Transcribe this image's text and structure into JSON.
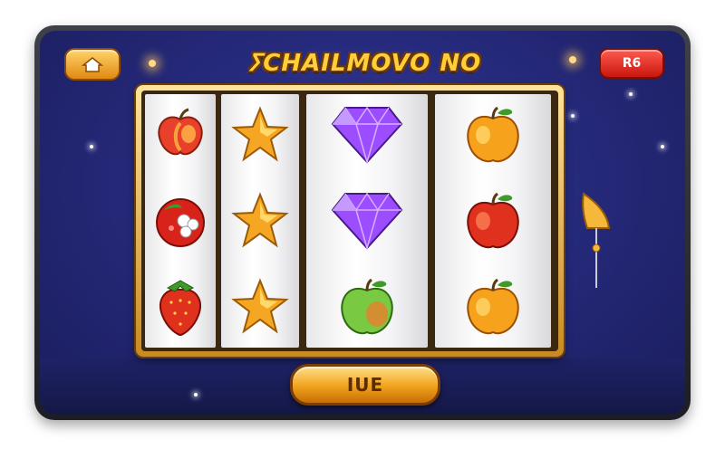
{
  "game": {
    "title": "ⵢCHAILMOVO NO",
    "badge_label": "R6",
    "spin_label": "IUE"
  },
  "reels": [
    {
      "symbols": [
        "peach",
        "strawberry-cut",
        "strawberry"
      ]
    },
    {
      "symbols": [
        "star",
        "star",
        "star"
      ]
    },
    {
      "symbols": [
        "diamond",
        "diamond",
        "green-apple"
      ]
    },
    {
      "symbols": [
        "orange-apple",
        "red-apple",
        "orange-apple"
      ]
    }
  ],
  "colors": {
    "background": "#262a7c",
    "gold": "#ffcf3a",
    "badge_red": "#e02a1e",
    "gem_purple": "#9b4dff"
  }
}
